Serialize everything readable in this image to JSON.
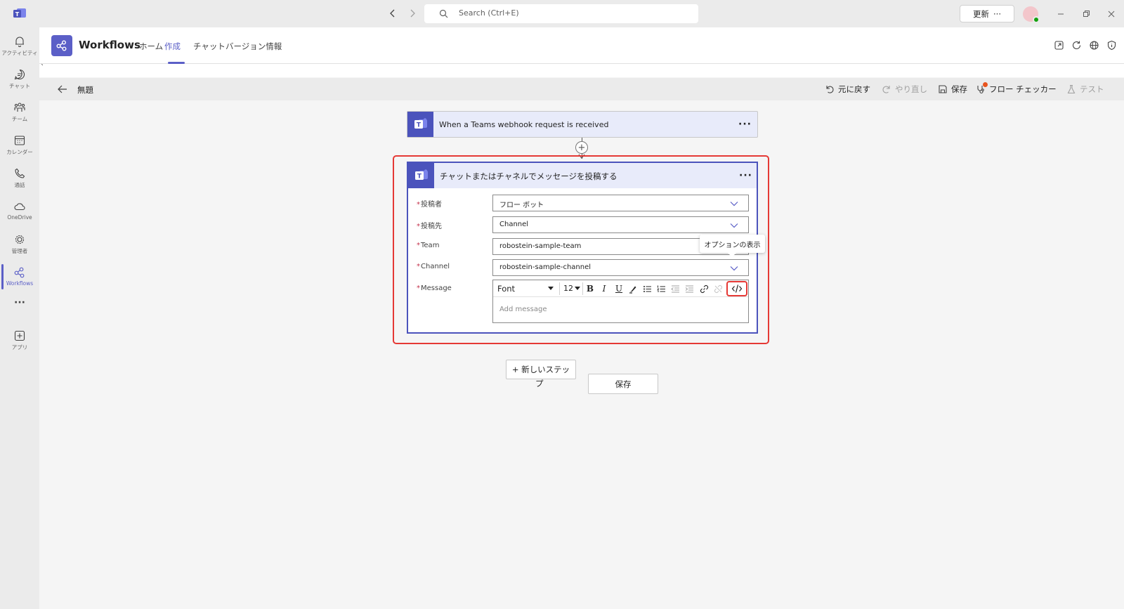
{
  "titlebar": {
    "search_placeholder": "Search (Ctrl+E)",
    "update_label": "更新",
    "update_more": "···"
  },
  "rail": {
    "items": [
      {
        "label": "アクティビティ",
        "icon": "bell-icon"
      },
      {
        "label": "チャット",
        "icon": "chat-icon"
      },
      {
        "label": "チーム",
        "icon": "teams-icon"
      },
      {
        "label": "カレンダー",
        "icon": "calendar-icon"
      },
      {
        "label": "通話",
        "icon": "phone-icon"
      },
      {
        "label": "OneDrive",
        "icon": "cloud-icon"
      },
      {
        "label": "管理者",
        "icon": "admin-gear-icon"
      },
      {
        "label": "Workflows",
        "icon": "workflows-icon"
      },
      {
        "label": "アプリ",
        "icon": "add-app-icon"
      }
    ],
    "more": "···"
  },
  "app": {
    "title": "Workflows",
    "tabs": [
      {
        "label": "ホーム",
        "active": false
      },
      {
        "label": "作成",
        "active": true
      },
      {
        "label": "チャット",
        "active": false
      },
      {
        "label": "バージョン情報",
        "active": false
      }
    ],
    "stray_mark": "`"
  },
  "cmdbar": {
    "title": "無題",
    "undo": "元に戻す",
    "redo": "やり直し",
    "save": "保存",
    "flow_checker": "フロー チェッカー",
    "test": "テスト"
  },
  "trigger": {
    "label": "When a Teams webhook request is received",
    "more": "···"
  },
  "action": {
    "title": "チャットまたはチャネルでメッセージを投稿する",
    "more": "···",
    "fields": [
      {
        "label": "投稿者",
        "value": "フロー ボット"
      },
      {
        "label": "投稿先",
        "value": "Channel"
      },
      {
        "label": "Team",
        "value": "robostein-sample-team"
      },
      {
        "label": "Channel",
        "value": "robostein-sample-channel"
      }
    ],
    "message_label": "Message",
    "font": "Font",
    "font_size": "12",
    "message_placeholder": "Add message",
    "tooltip": "オプションの表示"
  },
  "footer": {
    "new_step_line1": "+ 新しいステッ",
    "new_step_line2": "プ",
    "save": "保存"
  },
  "colors": {
    "brand": "#5b5fc7",
    "card_icon": "#4b53bc",
    "highlight": "#e53935",
    "required": "#c4314b"
  }
}
